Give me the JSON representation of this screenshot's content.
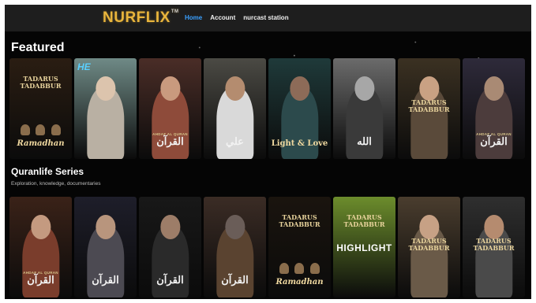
{
  "nav": {
    "logo": "NURFLIX",
    "tm": "TM",
    "links": [
      "Home",
      "Account",
      "nurcast station"
    ],
    "active_index": 0,
    "active_color": "#3aa0ff"
  },
  "featured": {
    "title": "Featured",
    "cards": [
      {
        "bg": "#2a1d12",
        "type": "tadarus",
        "title_top": "TADARUS",
        "title_bottom": "TADABBUR",
        "script": "Ramadhan"
      },
      {
        "bg": "#6f8a86",
        "type": "person",
        "figure": "#b9b0a3",
        "head": "#dcc4ad",
        "badge": "HE"
      },
      {
        "bg": "#4a2d27",
        "type": "person-caption",
        "figure": "#8e4b3a",
        "head": "#c99a7e",
        "caption_en": "AHDAF AL QURAN",
        "caption_ar": "القرآن"
      },
      {
        "bg": "#4b4a44",
        "type": "person-caption",
        "figure": "#d9d9d9",
        "head": "#b48c6f",
        "caption_ar": "علي"
      },
      {
        "bg": "#1f3a3a",
        "type": "person-caption",
        "figure": "#2c4a4c",
        "head": "#8d6b58",
        "caption_en": "Light & Love"
      },
      {
        "bg": "#6b6b6b",
        "type": "person-caption",
        "figure": "#3a3a3a",
        "head": "#a7a7a7",
        "caption_ar": "الله"
      },
      {
        "bg": "#3b3122",
        "type": "tadarus-person",
        "figure": "#5a4a3a",
        "head": "#c9a183",
        "title_top": "TADARUS",
        "title_bottom": "TADABBUR"
      },
      {
        "bg": "#2e2a3a",
        "type": "person-caption",
        "figure": "#4c3c3c",
        "head": "#a98a74",
        "caption_en": "AHDAF AL QURAN",
        "caption_ar": "القرآن"
      }
    ]
  },
  "series": {
    "title": "Quranlife Series",
    "subtitle": "Exploration, knowledge, documentaries",
    "cards": [
      {
        "bg": "#3a2218",
        "type": "person-caption",
        "figure": "#7a3d2c",
        "head": "#c49a80",
        "caption_en": "AHDAF AL QURAN",
        "caption_ar": "القرآن"
      },
      {
        "bg": "#1e1e2a",
        "type": "person-caption",
        "figure": "#4c4a52",
        "head": "#b8957d",
        "caption_ar": "القرآن"
      },
      {
        "bg": "#181818",
        "type": "person-caption",
        "figure": "#2a2a2a",
        "head": "#9d7d68",
        "caption_ar": "القرآن"
      },
      {
        "bg": "#3b2c25",
        "type": "person-caption",
        "figure": "#5a4330",
        "head": "#6a5d58",
        "caption_ar": "القرآن"
      },
      {
        "bg": "#1a140e",
        "type": "tadarus",
        "title_top": "TADARUS",
        "title_bottom": "TADABBUR",
        "script": "Ramadhan"
      },
      {
        "bg": "#6c8d2c",
        "type": "highlight",
        "title_top": "TADARUS",
        "title_bottom": "TADABBUR",
        "highlight": "HIGHLIGHT"
      },
      {
        "bg": "#4a3d2e",
        "type": "tadarus-person",
        "figure": "#6a5a48",
        "head": "#c7a185",
        "title_top": "TADARUS",
        "title_bottom": "TADABBUR"
      },
      {
        "bg": "#2f2f2f",
        "type": "tadarus-person",
        "figure": "#4a4a4a",
        "head": "#b58b6f",
        "title_top": "TADARUS",
        "title_bottom": "TADABBUR"
      }
    ]
  }
}
